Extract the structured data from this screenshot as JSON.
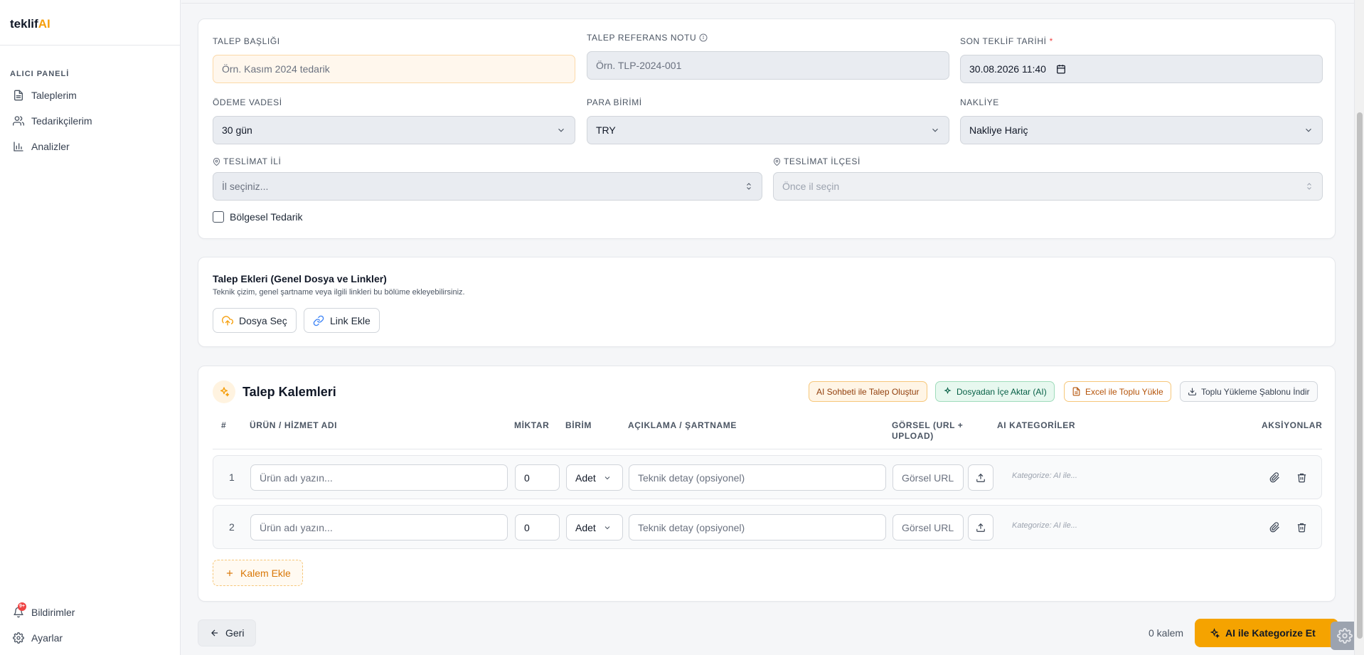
{
  "brand": {
    "name_prefix": "teklif",
    "name_suffix": "AI"
  },
  "sidebar": {
    "section": "ALICI PANELİ",
    "items": [
      {
        "label": "Taleplerim",
        "icon": "document-icon"
      },
      {
        "label": "Tedarikçilerim",
        "icon": "users-icon"
      },
      {
        "label": "Analizler",
        "icon": "bar-chart-icon"
      }
    ],
    "bottom": [
      {
        "label": "Bildirimler",
        "icon": "bell-icon",
        "badge": "9+"
      },
      {
        "label": "Ayarlar",
        "icon": "gear-icon"
      }
    ]
  },
  "form": {
    "title_label": "TALEP BAŞLIĞI",
    "title_placeholder": "Örn. Kasım 2024 tedarik",
    "ref_label": "TALEP REFERANS NOTU",
    "ref_placeholder": "Örn. TLP-2024-001",
    "deadline_label": "SON TEKLİF TARİHİ",
    "deadline_required": "*",
    "deadline_value": "30.08.2026 11:40",
    "payment_label": "ÖDEME VADESİ",
    "payment_value": "30 gün",
    "currency_label": "PARA BİRİMİ",
    "currency_value": "TRY",
    "shipping_label": "NAKLİYE",
    "shipping_value": "Nakliye Hariç",
    "city_label": "TESLİMAT İLİ",
    "city_placeholder": "İl seçiniz...",
    "district_label": "TESLİMAT İLÇESİ",
    "district_placeholder": "Önce il seçin",
    "regional_label": "Bölgesel Tedarik"
  },
  "attachments": {
    "title": "Talep Ekleri (Genel Dosya ve Linkler)",
    "desc": "Teknik çizim, genel şartname veya ilgili linkleri bu bölüme ekleyebilirsiniz.",
    "file_button": "Dosya Seç",
    "link_button": "Link Ekle"
  },
  "items": {
    "title": "Talep Kalemleri",
    "actions": {
      "ai_chat": "AI Sohbeti ile Talep Oluştur",
      "file_import": "Dosyadan İçe Aktar (AI)",
      "excel": "Excel ile Toplu Yükle",
      "template": "Toplu Yükleme Şablonu İndir"
    },
    "columns": {
      "num": "#",
      "name": "ÜRÜN / HİZMET ADI",
      "qty": "MİKTAR",
      "unit": "BİRİM",
      "desc": "AÇIKLAMA / ŞARTNAME",
      "image": "GÖRSEL (URL + UPLOAD)",
      "ai_cat": "AI KATEGORİLER",
      "actions": "AKSİYONLAR"
    },
    "rows": [
      {
        "num": "1",
        "name_placeholder": "Ürün adı yazın...",
        "qty": "0",
        "unit": "Adet",
        "desc_placeholder": "Teknik detay (opsiyonel)",
        "image_placeholder": "Görsel URL",
        "ai_cat": "Kategorize: AI ile..."
      },
      {
        "num": "2",
        "name_placeholder": "Ürün adı yazın...",
        "qty": "0",
        "unit": "Adet",
        "desc_placeholder": "Teknik detay (opsiyonel)",
        "image_placeholder": "Görsel URL",
        "ai_cat": "Kategorize: AI ile..."
      }
    ],
    "add_button": "Kalem Ekle"
  },
  "footer": {
    "back": "Geri",
    "count": "0 kalem",
    "primary": "AI ile Kategorize Et"
  },
  "colors": {
    "accent": "#f5a300",
    "accent_text": "#d97706",
    "success_bg": "#e7f8ef"
  }
}
